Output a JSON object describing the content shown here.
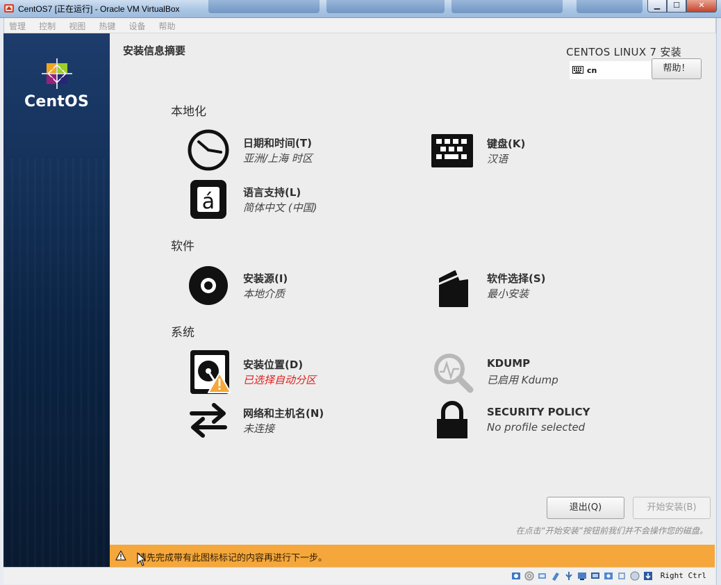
{
  "window": {
    "title": "CentOS7 [正在运行] - Oracle VM VirtualBox",
    "controls": {
      "minimize": "▁",
      "maximize": "☐",
      "close": "✕"
    }
  },
  "menubar": {
    "items": [
      {
        "label": "管理"
      },
      {
        "label": "控制"
      },
      {
        "label": "视图"
      },
      {
        "label": "热键"
      },
      {
        "label": "设备"
      },
      {
        "label": "帮助"
      }
    ]
  },
  "sidebar": {
    "logo_text": "CentOS"
  },
  "header": {
    "page_title": "安装信息摘要",
    "product_title": "CENTOS LINUX 7 安装",
    "keyboard_layout": "cn",
    "help_label": "帮助！"
  },
  "sections": {
    "localization": "本地化",
    "software": "软件",
    "system": "系统"
  },
  "spokes": {
    "datetime": {
      "name": "日期和时间(T)",
      "status": "亚洲/上海 时区"
    },
    "keyboard": {
      "name": "键盘(K)",
      "status": "汉语"
    },
    "language": {
      "name": "语言支持(L)",
      "status": "简体中文 (中国)"
    },
    "source": {
      "name": "安装源(I)",
      "status": "本地介质"
    },
    "software": {
      "name": "软件选择(S)",
      "status": "最小安装"
    },
    "destination": {
      "name": "安装位置(D)",
      "status": "已选择自动分区"
    },
    "kdump": {
      "name": "KDUMP",
      "status": "已启用 Kdump"
    },
    "network": {
      "name": "网络和主机名(N)",
      "status": "未连接"
    },
    "security": {
      "name": "SECURITY POLICY",
      "status": "No profile selected"
    }
  },
  "footer": {
    "quit_label": "退出(Q)",
    "begin_label": "开始安装(B)",
    "notice": "在点击“开始安装”按钮前我们并不会操作您的磁盘。"
  },
  "warning_bar": {
    "text": "请先完成带有此图标标记的内容再进行下一步。"
  },
  "statusbar": {
    "host_key": "Right Ctrl"
  },
  "colors": {
    "warning_orange": "#f5a73b",
    "error_red": "#e0201b",
    "sidebar_blue": "#16345e"
  }
}
